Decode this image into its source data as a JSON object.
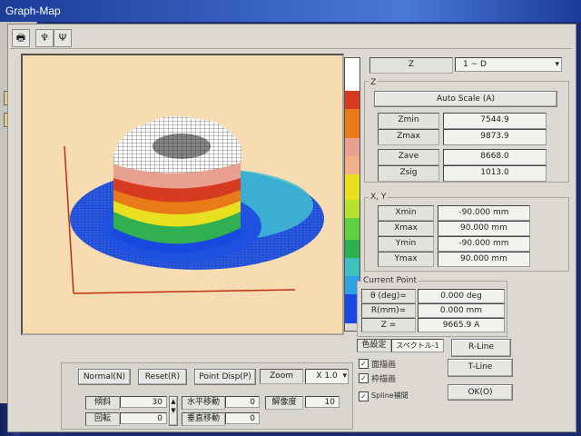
{
  "window": {
    "title": "Graph-Map"
  },
  "toolbar": {
    "print_icon": "printer-icon",
    "tool2_icon": "fork-icon",
    "tool3_icon": "tree-icon"
  },
  "colors": {
    "scale": [
      "#ffffff",
      "#d63a20",
      "#e87a18",
      "#e8a090",
      "#f0b088",
      "#e8e020",
      "#b8e030",
      "#60d040",
      "#2cb050",
      "#40c0c0",
      "#30a0e0",
      "#1848e0",
      "#1030d0"
    ],
    "plot_bg": "#f6dcb0",
    "axis": "#c03010"
  },
  "z_select": {
    "label": "Z",
    "value": "1 ~ D"
  },
  "z_group": {
    "title": "Z",
    "auto_scale": "Auto Scale (A)",
    "rows": [
      {
        "label": "Zmin",
        "value": "7544.9"
      },
      {
        "label": "Zmax",
        "value": "9873.9"
      },
      {
        "label": "Zave",
        "value": "8668.0"
      },
      {
        "label": "Zsig",
        "value": "1013.0"
      }
    ]
  },
  "xy_group": {
    "title": "X, Y",
    "rows": [
      {
        "label": "Xmin",
        "value": "-90.000 mm"
      },
      {
        "label": "Xmax",
        "value": "90.000 mm"
      },
      {
        "label": "Ymin",
        "value": "-90.000 mm"
      },
      {
        "label": "Ymax",
        "value": "90.000 mm"
      }
    ]
  },
  "current_point": {
    "title": "Current Point",
    "rows": [
      {
        "label": "θ (deg)=",
        "value": "0.000 deg"
      },
      {
        "label": "R(mm)=",
        "value": "0.000 mm"
      },
      {
        "label": "Z =",
        "value": "9665.9 A"
      }
    ]
  },
  "bottom": {
    "normal": "Normal(N)",
    "reset": "Reset(R)",
    "point_disp": "Point Disp(P)",
    "zoom_label": "Zoom",
    "zoom_value": "X 1.0",
    "r1_label": "傾斜",
    "r1_value": "30",
    "r2_label": "回転",
    "r2_value": "0",
    "h_move_label": "水平移動",
    "h_move_value": "0",
    "v_move_label": "垂直移動",
    "v_move_value": "0",
    "resolution_label": "解像度",
    "resolution_value": "10"
  },
  "color_settings": {
    "label": "色設定",
    "value": "スペクトル-1",
    "surface": "面描画",
    "wire": "枠描画",
    "spline": "Spline補間"
  },
  "buttons": {
    "r_line": "R-Line",
    "t_line": "T-Line",
    "ok": "OK(O)"
  }
}
